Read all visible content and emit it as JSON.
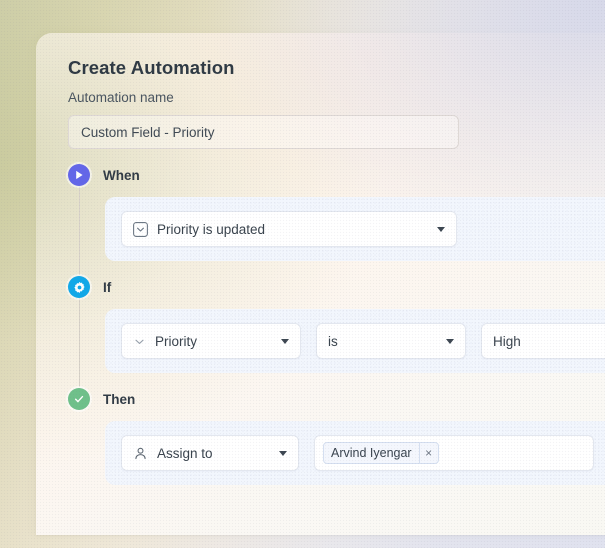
{
  "card": {
    "title": "Create Automation",
    "name_field": {
      "label": "Automation name",
      "value": "Custom Field - Priority",
      "placeholder": "Automation name"
    }
  },
  "steps": [
    {
      "key": "when",
      "label": "When",
      "badge_icon": "play-icon",
      "badge_color": "#6366e8",
      "trigger": {
        "icon": "custom-field-icon",
        "value": "Priority is updated",
        "caret_icon": "chevron-down-icon"
      }
    },
    {
      "key": "if",
      "label": "If",
      "badge_icon": "gear-icon",
      "badge_color": "#11a8e8",
      "condition": {
        "field": {
          "icon": "chevron-small-down-icon",
          "value": "Priority",
          "caret_icon": "chevron-down-icon"
        },
        "operator": {
          "value": "is",
          "caret_icon": "chevron-down-icon"
        },
        "value": {
          "value": "High"
        }
      }
    },
    {
      "key": "then",
      "label": "Then",
      "badge_icon": "check-icon",
      "badge_color": "#6fc08a",
      "action": {
        "type": {
          "icon": "person-icon",
          "value": "Assign to",
          "caret_icon": "chevron-down-icon"
        },
        "assignees": [
          {
            "name": "Arvind Iyengar",
            "remove_label": "×"
          }
        ]
      }
    }
  ]
}
